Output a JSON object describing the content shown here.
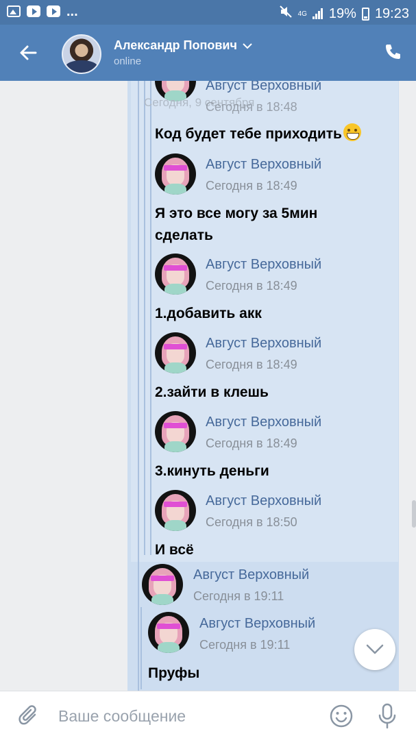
{
  "status_bar": {
    "dots": "...",
    "network": "4G",
    "battery": "19%",
    "time": "19:23"
  },
  "header": {
    "name": "Александр Попович",
    "status": "online"
  },
  "date_overlay": "Сегодня, 9 сентября",
  "messages": [
    {
      "sender": "Август Верховный",
      "time": "Сегодня в 18:48",
      "text": "Код будет тебе приходить"
    },
    {
      "sender": "Август Верховный",
      "time": "Сегодня в 18:49",
      "text_line1": "Я это все могу за 5мин",
      "text_line2": "сделать"
    },
    {
      "sender": "Август Верховный",
      "time": "Сегодня в 18:49",
      "text": "1.добавить акк"
    },
    {
      "sender": "Август Верховный",
      "time": "Сегодня в 18:49",
      "text": "2.зайти в клешь"
    },
    {
      "sender": "Август Верховный",
      "time": "Сегодня в 18:49",
      "text": "3.кинуть деньги"
    },
    {
      "sender": "Август Верховный",
      "time": "Сегодня в 18:50",
      "text": "И  всё"
    },
    {
      "sender": "Август Верховный",
      "time": "Сегодня в 19:11"
    },
    {
      "sender": "Август Верховный",
      "time": "Сегодня в 19:11",
      "text": "Пруфы"
    }
  ],
  "composer": {
    "placeholder": "Ваше сообщение"
  },
  "colors": {
    "header": "#5181b8",
    "status_bar": "#4a76a8",
    "bubble": "#d7e4f3",
    "sender": "#46699a"
  },
  "icons": [
    "image-icon",
    "youtube-icon",
    "mute-icon",
    "signal-icon",
    "battery-icon",
    "back-arrow-icon",
    "chevron-down-icon",
    "phone-icon",
    "scroll-down-icon",
    "paperclip-icon",
    "smile-icon",
    "microphone-icon"
  ]
}
